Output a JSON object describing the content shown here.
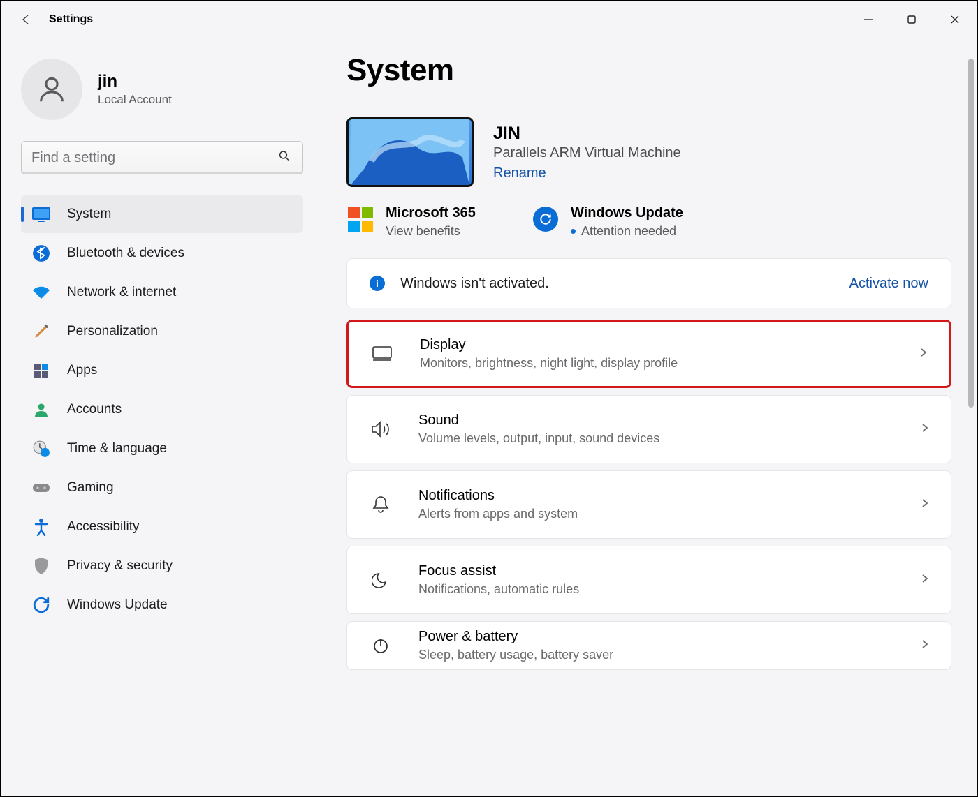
{
  "app_title": "Settings",
  "user": {
    "name": "jin",
    "type": "Local Account"
  },
  "search": {
    "placeholder": "Find a setting"
  },
  "nav": [
    {
      "label": "System"
    },
    {
      "label": "Bluetooth & devices"
    },
    {
      "label": "Network & internet"
    },
    {
      "label": "Personalization"
    },
    {
      "label": "Apps"
    },
    {
      "label": "Accounts"
    },
    {
      "label": "Time & language"
    },
    {
      "label": "Gaming"
    },
    {
      "label": "Accessibility"
    },
    {
      "label": "Privacy & security"
    },
    {
      "label": "Windows Update"
    }
  ],
  "page": {
    "title": "System",
    "device_name": "JIN",
    "device_desc": "Parallels ARM Virtual Machine",
    "rename": "Rename",
    "m365_title": "Microsoft 365",
    "m365_sub": "View benefits",
    "wu_title": "Windows Update",
    "wu_sub": "Attention needed",
    "activation_text": "Windows isn't activated.",
    "activation_link": "Activate now"
  },
  "settings": [
    {
      "title": "Display",
      "sub": "Monitors, brightness, night light, display profile"
    },
    {
      "title": "Sound",
      "sub": "Volume levels, output, input, sound devices"
    },
    {
      "title": "Notifications",
      "sub": "Alerts from apps and system"
    },
    {
      "title": "Focus assist",
      "sub": "Notifications, automatic rules"
    },
    {
      "title": "Power & battery",
      "sub": "Sleep, battery usage, battery saver"
    }
  ]
}
